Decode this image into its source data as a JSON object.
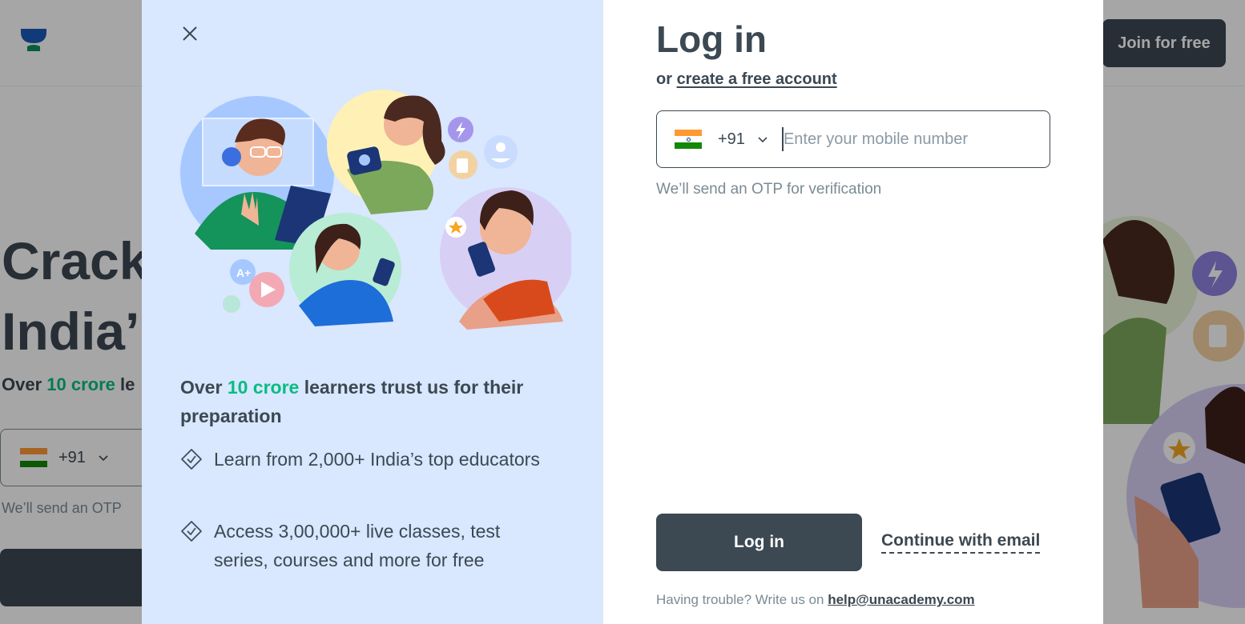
{
  "background": {
    "join_label": "Join for free",
    "hero_line1": "Crack",
    "hero_line2": "India’",
    "sub_prefix": "Over ",
    "sub_highlight": "10 crore",
    "sub_suffix": " le",
    "phone_code": "+91",
    "otp_note": "We’ll send an OTP",
    "accent_color": "#08bd80"
  },
  "modal": {
    "left": {
      "trust_prefix": "Over ",
      "trust_highlight": "10 crore",
      "trust_suffix": " learners trust us for their preparation",
      "bullets": [
        {
          "text": "Learn from 2,000+ India’s top educators",
          "icon": "check-diamond-icon"
        },
        {
          "text": "Access 3,00,000+ live classes, test series, courses and more for free",
          "icon": "check-diamond-icon"
        }
      ]
    },
    "right": {
      "title": "Log in",
      "or_text": "or ",
      "create_account_label": "create a free account",
      "country_code": "+91",
      "mobile_placeholder": "Enter your mobile number",
      "mobile_value": "",
      "otp_note": "We’ll send an OTP for verification",
      "login_label": "Log in",
      "email_label": "Continue with email",
      "help_prefix": "Having trouble? Write us on ",
      "help_email": "help@unacademy.com"
    }
  }
}
